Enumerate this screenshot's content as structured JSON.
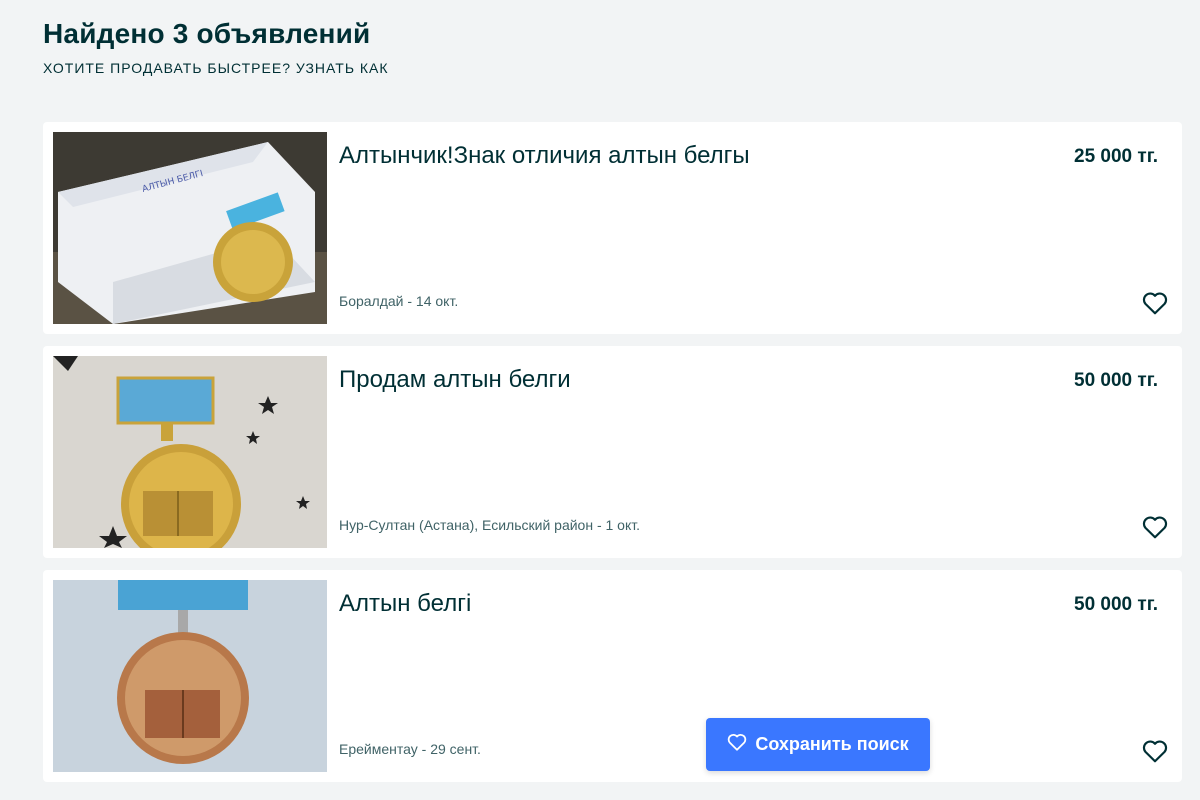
{
  "header": {
    "title": "Найдено 3 объявлений",
    "subtitle_text": "ХОТИТЕ ПРОДАВАТЬ БЫСТРЕЕ?",
    "subtitle_link": "УЗНАТЬ КАК"
  },
  "listings": [
    {
      "title": "Алтынчик!Знак отличия алтын белгы",
      "price": "25 000 тг.",
      "location_date": "Боралдай - 14 окт.",
      "image_icon": "medal-in-box-photo",
      "favorite_icon": "heart-outline-icon"
    },
    {
      "title": "Продам алтын белги",
      "price": "50 000 тг.",
      "location_date": "Нур-Султан (Астана), Есильский район - 1 окт.",
      "image_icon": "medal-with-stars-photo",
      "favorite_icon": "heart-outline-icon"
    },
    {
      "title": "Алтын белгі",
      "price": "50 000 тг.",
      "location_date": "Ерейментау - 29 сент.",
      "image_icon": "medal-photo",
      "favorite_icon": "heart-outline-icon"
    }
  ],
  "save_search": {
    "label": "Сохранить поиск",
    "icon": "heart-outline-icon"
  },
  "colors": {
    "background": "#f2f4f5",
    "text": "#002f34",
    "muted": "#406367",
    "accent": "#3a77ff",
    "card": "#ffffff"
  }
}
